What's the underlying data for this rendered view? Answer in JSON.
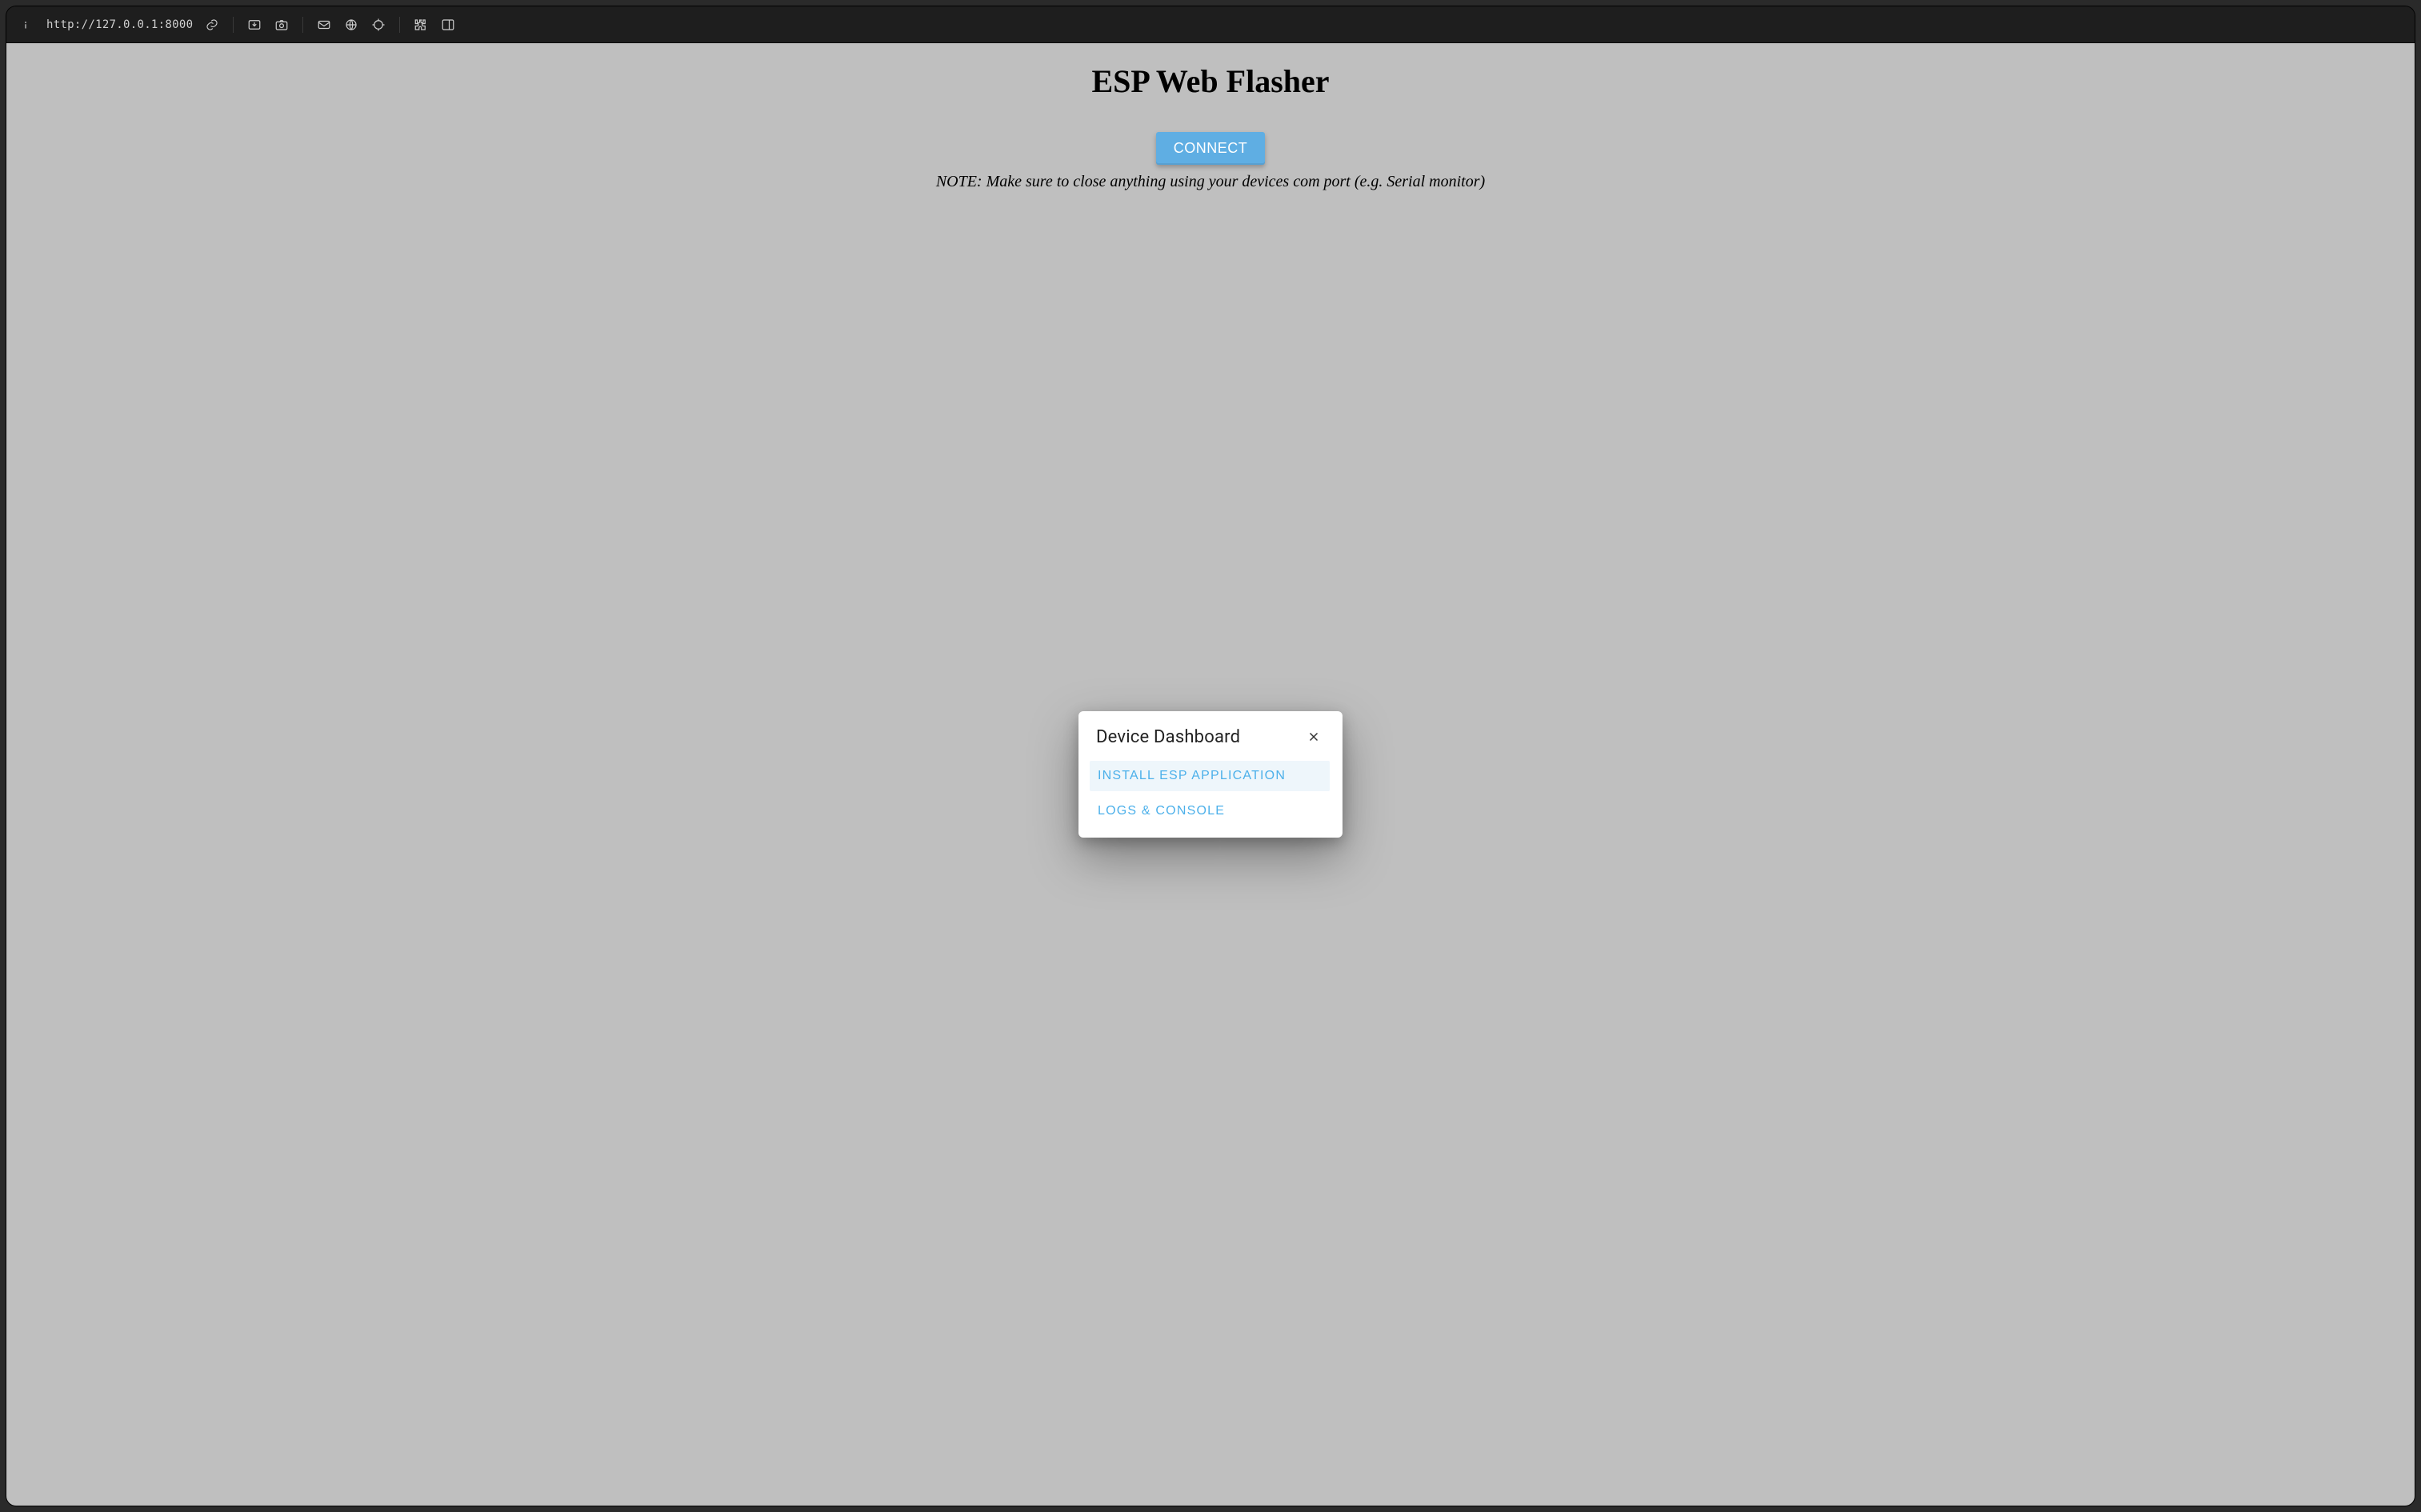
{
  "browser": {
    "url": "http://127.0.0.1:8000",
    "icons": {
      "info": "info-icon",
      "link": "link-icon",
      "download": "download-tray-icon",
      "camera": "camera-icon",
      "mail": "mail-icon",
      "globe": "globe-icon",
      "crosshair": "crosshair-icon",
      "puzzle": "puzzle-icon",
      "panel": "panel-right-icon"
    }
  },
  "page": {
    "title": "ESP Web Flasher",
    "connect_label": "CONNECT",
    "note": "NOTE: Make sure to close anything using your devices com port (e.g. Serial monitor)"
  },
  "modal": {
    "title": "Device Dashboard",
    "items": [
      {
        "label": "INSTALL ESP APPLICATION"
      },
      {
        "label": "LOGS & CONSOLE"
      }
    ]
  }
}
